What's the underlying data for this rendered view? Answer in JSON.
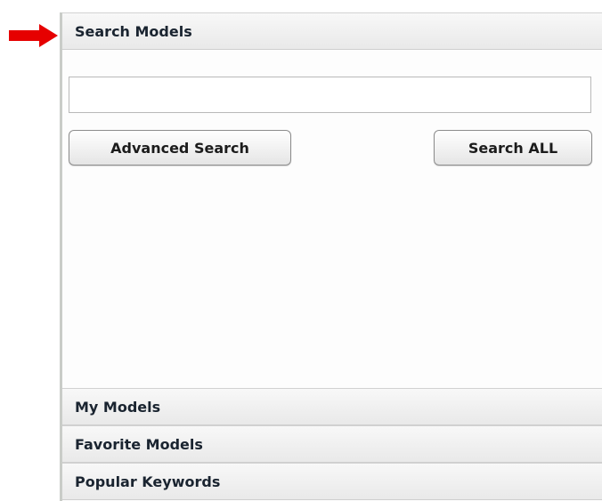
{
  "arrow": {
    "color": "#e60000",
    "icon": "right-arrow-icon"
  },
  "panel": {
    "search_models": {
      "header": "Search Models",
      "input": {
        "value": "",
        "placeholder": ""
      },
      "advanced_search_label": "Advanced Search",
      "search_all_label": "Search ALL"
    },
    "sections": [
      {
        "label": "My Models"
      },
      {
        "label": "Favorite Models"
      },
      {
        "label": "Popular Keywords"
      }
    ]
  }
}
